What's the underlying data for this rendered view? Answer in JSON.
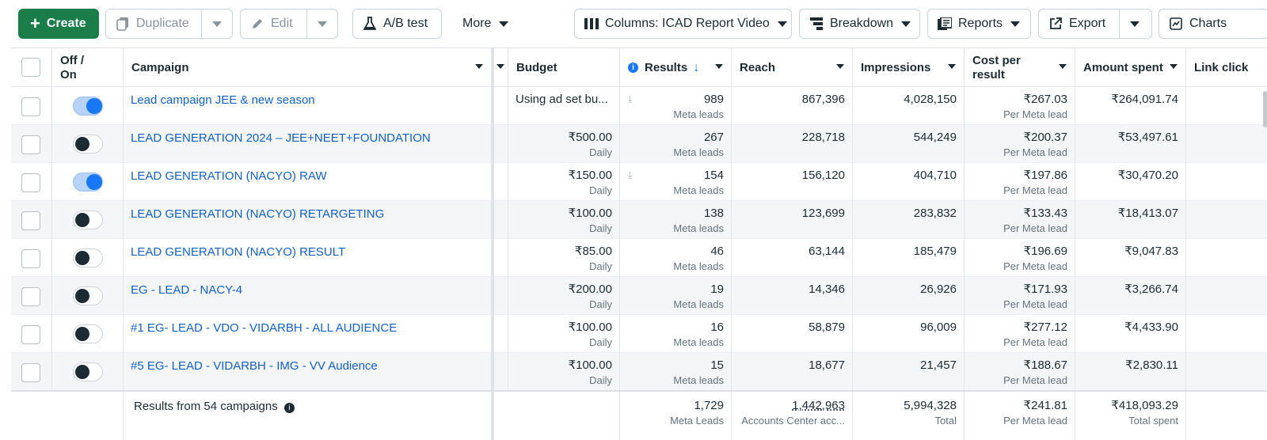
{
  "toolbar": {
    "create": "Create",
    "duplicate": "Duplicate",
    "edit": "Edit",
    "ab_test": "A/B test",
    "more": "More",
    "columns": "Columns: ICAD Report Video",
    "breakdown": "Breakdown",
    "reports": "Reports",
    "export": "Export",
    "charts": "Charts"
  },
  "headers": {
    "off_on": "Off / On",
    "campaign": "Campaign",
    "budget": "Budget",
    "results": "Results",
    "reach": "Reach",
    "impressions": "Impressions",
    "cost_per_result": "Cost per result",
    "amount_spent": "Amount spent",
    "link_clicks": "Link click"
  },
  "rows": [
    {
      "on": true,
      "name": "Lead campaign JEE & new season",
      "budget": "Using ad set bu...",
      "budget_sub": "",
      "download": true,
      "results": "989",
      "results_sub": "Meta leads",
      "reach": "867,396",
      "impressions": "4,028,150",
      "cpr": "₹267.03",
      "cpr_sub": "Per Meta lead",
      "spent": "₹264,091.74"
    },
    {
      "on": false,
      "name": "LEAD GENERATION 2024 – JEE+NEET+FOUNDATION",
      "budget": "₹500.00",
      "budget_sub": "Daily",
      "download": false,
      "results": "267",
      "results_sub": "Meta leads",
      "reach": "228,718",
      "impressions": "544,249",
      "cpr": "₹200.37",
      "cpr_sub": "Per Meta lead",
      "spent": "₹53,497.61"
    },
    {
      "on": true,
      "name": "LEAD GENERATION (NACYO) RAW",
      "budget": "₹150.00",
      "budget_sub": "Daily",
      "download": true,
      "results": "154",
      "results_sub": "Meta leads",
      "reach": "156,120",
      "impressions": "404,710",
      "cpr": "₹197.86",
      "cpr_sub": "Per Meta lead",
      "spent": "₹30,470.20"
    },
    {
      "on": false,
      "name": "LEAD GENERATION (NACYO) RETARGETING",
      "budget": "₹100.00",
      "budget_sub": "Daily",
      "download": false,
      "results": "138",
      "results_sub": "Meta leads",
      "reach": "123,699",
      "impressions": "283,832",
      "cpr": "₹133.43",
      "cpr_sub": "Per Meta lead",
      "spent": "₹18,413.07"
    },
    {
      "on": false,
      "name": "LEAD GENERATION (NACYO) RESULT",
      "budget": "₹85.00",
      "budget_sub": "Daily",
      "download": false,
      "results": "46",
      "results_sub": "Meta leads",
      "reach": "63,144",
      "impressions": "185,479",
      "cpr": "₹196.69",
      "cpr_sub": "Per Meta lead",
      "spent": "₹9,047.83"
    },
    {
      "on": false,
      "name": "EG - LEAD - NACY-4",
      "budget": "₹200.00",
      "budget_sub": "Daily",
      "download": false,
      "results": "19",
      "results_sub": "Meta leads",
      "reach": "14,346",
      "impressions": "26,926",
      "cpr": "₹171.93",
      "cpr_sub": "Per Meta lead",
      "spent": "₹3,266.74"
    },
    {
      "on": false,
      "name": "#1 EG- LEAD - VDO - VIDARBH - ALL AUDIENCE",
      "budget": "₹100.00",
      "budget_sub": "Daily",
      "download": false,
      "results": "16",
      "results_sub": "Meta leads",
      "reach": "58,879",
      "impressions": "96,009",
      "cpr": "₹277.12",
      "cpr_sub": "Per Meta lead",
      "spent": "₹4,433.90"
    },
    {
      "on": false,
      "name": "#5 EG- LEAD - VIDARBH - IMG - VV Audience",
      "budget": "₹100.00",
      "budget_sub": "Daily",
      "download": false,
      "results": "15",
      "results_sub": "Meta leads",
      "reach": "18,677",
      "impressions": "21,457",
      "cpr": "₹188.67",
      "cpr_sub": "Per Meta lead",
      "spent": "₹2,830.11"
    }
  ],
  "footer": {
    "label": "Results from 54 campaigns",
    "results": "1,729",
    "results_sub": "Meta Leads",
    "reach": "1,442,963",
    "reach_sub": "Accounts Center acc...",
    "impressions": "5,994,328",
    "impressions_sub": "Total",
    "cpr": "₹241.81",
    "cpr_sub": "Per Meta lead",
    "spent": "₹418,093.29",
    "spent_sub": "Total spent"
  },
  "colors": {
    "create_bg": "#1a7d4a",
    "link": "#1461c6",
    "toggle_on": "#1877f2"
  }
}
